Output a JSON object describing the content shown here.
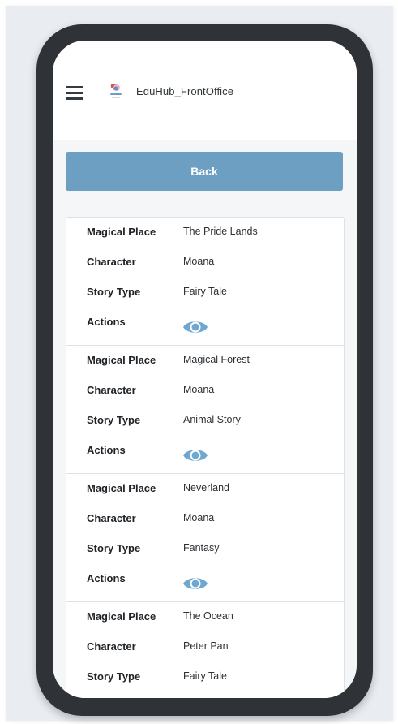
{
  "app": {
    "title": "EduHub_FrontOffice"
  },
  "toolbar": {
    "back_label": "Back"
  },
  "labels": {
    "place": "Magical Place",
    "character": "Character",
    "story_type": "Story Type",
    "actions": "Actions"
  },
  "records": [
    {
      "place": "The Pride Lands",
      "character": "Moana",
      "story_type": "Fairy Tale"
    },
    {
      "place": "Magical Forest",
      "character": "Moana",
      "story_type": "Animal Story"
    },
    {
      "place": "Neverland",
      "character": "Moana",
      "story_type": "Fantasy"
    },
    {
      "place": "The Ocean",
      "character": "Peter Pan",
      "story_type": "Fairy Tale"
    }
  ],
  "icons": {
    "menu": "hamburger-menu-icon",
    "logo": "eduhub-logo",
    "view": "eye-icon"
  },
  "colors": {
    "accent": "#6c9fc2",
    "eye": "#6ea7cf",
    "frame": "#2f3337"
  }
}
